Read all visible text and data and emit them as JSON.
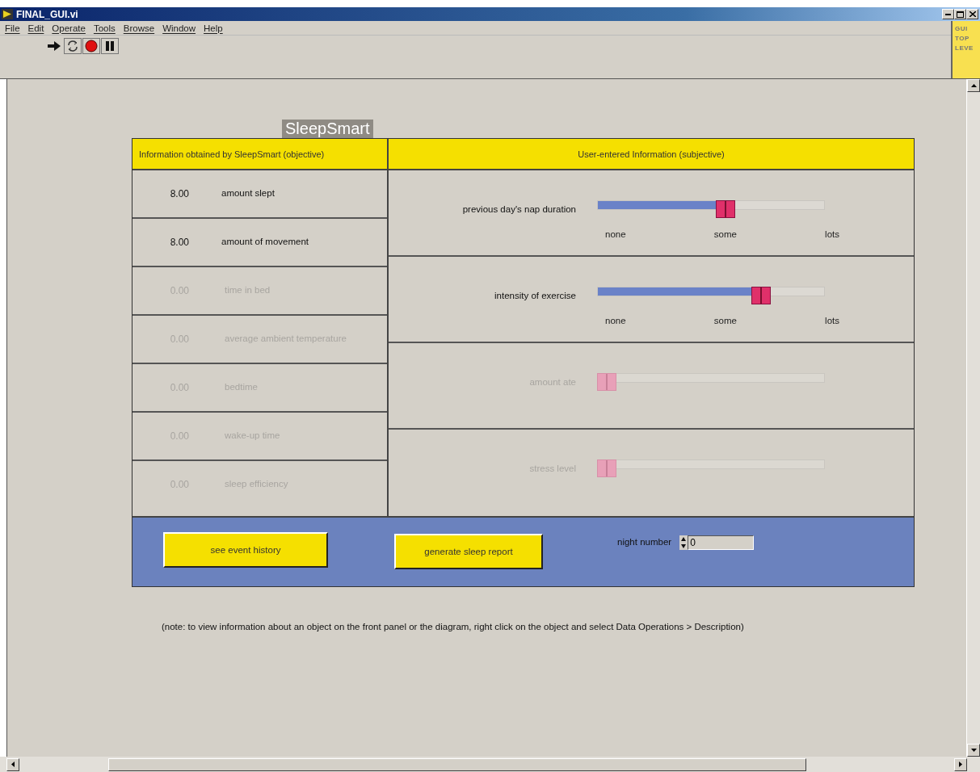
{
  "window": {
    "title": "FINAL_GUI.vi"
  },
  "menu": [
    "File",
    "Edit",
    "Operate",
    "Tools",
    "Browse",
    "Window",
    "Help"
  ],
  "toolbar": [
    {
      "kind": "run"
    },
    {
      "kind": "loop"
    },
    {
      "kind": "abort"
    },
    {
      "kind": "pause"
    }
  ],
  "hierarchy_badge": [
    "GUI",
    "TOP",
    "LEVE"
  ],
  "panel_title": "SleepSmart",
  "objective": {
    "header": "Information obtained by SleepSmart (objective)",
    "rows": [
      {
        "value": "8.00",
        "label": "amount slept",
        "disabled": false
      },
      {
        "value": "8.00",
        "label": "amount of movement",
        "disabled": false
      },
      {
        "value": "0.00",
        "label": "time in bed",
        "disabled": true
      },
      {
        "value": "0.00",
        "label": "average ambient temperature",
        "disabled": true
      },
      {
        "value": "0.00",
        "label": "bedtime",
        "disabled": true
      },
      {
        "value": "0.00",
        "label": "wake-up time",
        "disabled": true
      },
      {
        "value": "0.00",
        "label": "sleep efficiency",
        "disabled": true
      }
    ]
  },
  "subjective": {
    "header": "User-entered Information (subjective)",
    "sliders": [
      {
        "label": "previous day's nap duration",
        "level": 0.57,
        "disabled": false,
        "scale": [
          "none",
          "some",
          "lots"
        ]
      },
      {
        "label": "intensity of exercise",
        "level": 0.74,
        "disabled": false,
        "scale": [
          "none",
          "some",
          "lots"
        ]
      },
      {
        "label": "amount ate",
        "level": 0,
        "disabled": true
      },
      {
        "label": "stress level",
        "level": 0,
        "disabled": true
      }
    ]
  },
  "buttons": [
    "see event history",
    "generate sleep report"
  ],
  "night_number": {
    "label": "night number",
    "value": "0"
  },
  "note": "(note: to view information about an object on the front panel or the diagram, right click on the object and select Data Operations > Description)"
}
